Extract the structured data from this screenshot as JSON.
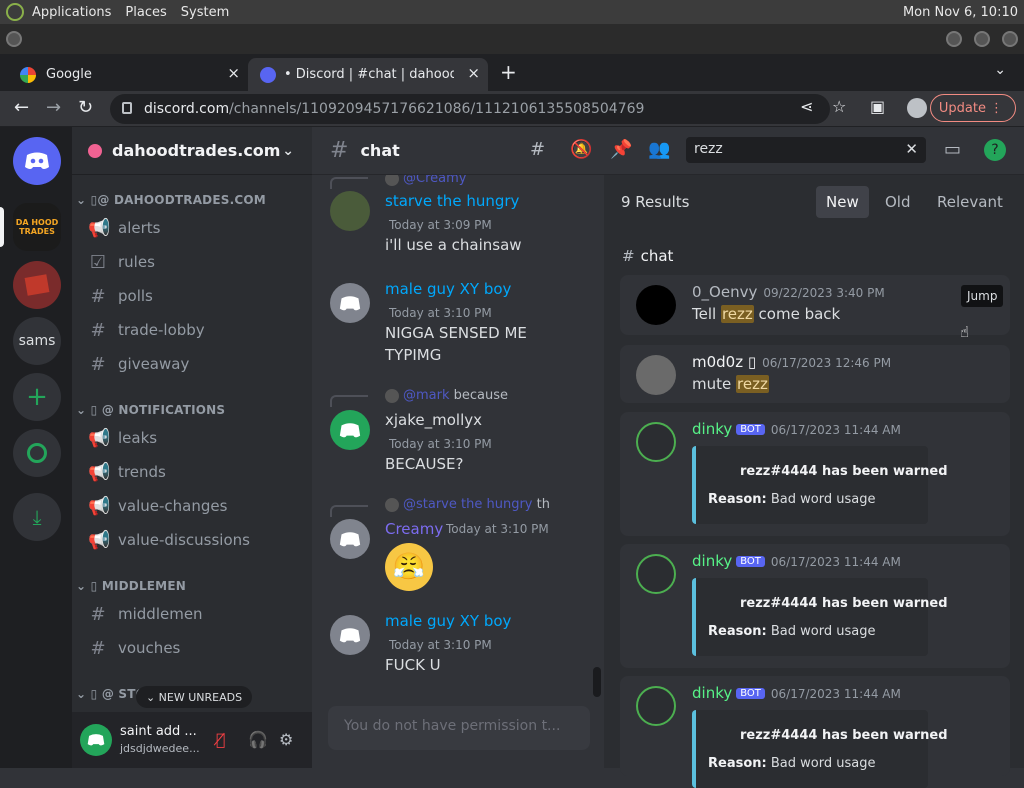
{
  "os": {
    "menus": [
      "Applications",
      "Places",
      "System"
    ],
    "clock": "Mon Nov 6, 10:10"
  },
  "browser": {
    "tabs": [
      {
        "title": "Google",
        "close": "×"
      },
      {
        "title": "• Discord | #chat | dahoodtrade",
        "close": "×"
      }
    ],
    "new_tab": "+",
    "tab_menu": "⌄",
    "url_host": "discord.com",
    "url_path": "/channels/1109209457176621086/1112106135508504769",
    "update_label": "Update",
    "accent": "#f28b82"
  },
  "rail": {
    "servers": [
      {
        "name": "discord-home",
        "label": ""
      },
      {
        "name": "dahoodtrades",
        "label": "DA HOOD TRADES"
      },
      {
        "name": "server-red",
        "label": ""
      },
      {
        "name": "sams",
        "label": "sams"
      },
      {
        "name": "add-server",
        "label": "+"
      },
      {
        "name": "explore",
        "label": ""
      },
      {
        "name": "download",
        "label": ""
      }
    ]
  },
  "sidebar": {
    "guild_name": "dahoodtrades.com",
    "categories": [
      {
        "label": "⌄ ▯@ DAHOODTRADES.COM"
      },
      {
        "label": "⌄ ▯ @ NOTIFICATIONS"
      },
      {
        "label": "⌄ ▯ MIDDLEMEN"
      },
      {
        "label": "⌄ ▯ @ STO"
      }
    ],
    "channels": [
      {
        "icon": "📢",
        "name": "alerts"
      },
      {
        "icon": "☑",
        "name": "rules"
      },
      {
        "icon": "#",
        "name": "polls"
      },
      {
        "icon": "#",
        "name": "trade-lobby"
      },
      {
        "icon": "#",
        "name": "giveaway"
      },
      {
        "icon": "📢",
        "name": "leaks"
      },
      {
        "icon": "📢",
        "name": "trends"
      },
      {
        "icon": "📢",
        "name": "value-changes"
      },
      {
        "icon": "📢",
        "name": "value-discussions"
      },
      {
        "icon": "#",
        "name": "middlemen"
      },
      {
        "icon": "#",
        "name": "vouches"
      }
    ],
    "new_unreads": "NEW UNREADS",
    "user": {
      "name": "saint add ...",
      "tag": "jdsdjdwedee..."
    }
  },
  "chat": {
    "channel": "chat",
    "input_placeholder": "You do not have permission t...",
    "messages": [
      {
        "reply": "@Creamy",
        "author": "starve the hungry",
        "ts": "Today at 3:09 PM",
        "body": "i'll use a chainsaw"
      },
      {
        "author": "male guy XY boy",
        "ts": "Today at 3:10 PM",
        "body": "NIGGA SENSED ME TYPIMG"
      },
      {
        "reply_mention": "@mark",
        "reply_text": " because",
        "author": "xjake_mollyx",
        "ts": "Today at 3:10 PM",
        "body": "BECAUSE?"
      },
      {
        "reply_mention": "@starve the hungry",
        "reply_text": " th",
        "author": "Creamy",
        "ts": "Today at 3:10 PM",
        "body": "😤"
      },
      {
        "author": "male guy XY boy",
        "ts": "Today at 3:10 PM",
        "body": "FUCK U"
      }
    ]
  },
  "search": {
    "query": "rezz",
    "count": "9 Results",
    "sorts": [
      "New",
      "Old",
      "Relevant"
    ],
    "channel": "chat",
    "jump": "Jump",
    "results": [
      {
        "author": "0_Oenvy",
        "date": "09/22/2023 3:40 PM",
        "pre": "Tell ",
        "hit": "rezz",
        "post": " come back"
      },
      {
        "author": "m0d0z ▯",
        "date": "06/17/2023 12:46 PM",
        "pre": "mute ",
        "hit": "rezz",
        "post": ""
      },
      {
        "author": "dinky",
        "bot": "BOT",
        "date": "06/17/2023 11:44 AM",
        "embed_title": "rezz#4444 has been warned",
        "reason_label": "Reason:",
        "reason": " Bad word usage"
      },
      {
        "author": "dinky",
        "bot": "BOT",
        "date": "06/17/2023 11:44 AM",
        "embed_title": "rezz#4444 has been warned",
        "reason_label": "Reason:",
        "reason": " Bad word usage"
      },
      {
        "author": "dinky",
        "bot": "BOT",
        "date": "06/17/2023 11:44 AM",
        "embed_title": "rezz#4444 has been warned",
        "reason_label": "Reason:",
        "reason": " Bad word usage"
      }
    ]
  },
  "colors": {
    "blurple": "#5865f2",
    "green": "#23a55a",
    "bot_name": "#57f287",
    "link_blue": "#00a8fc"
  }
}
